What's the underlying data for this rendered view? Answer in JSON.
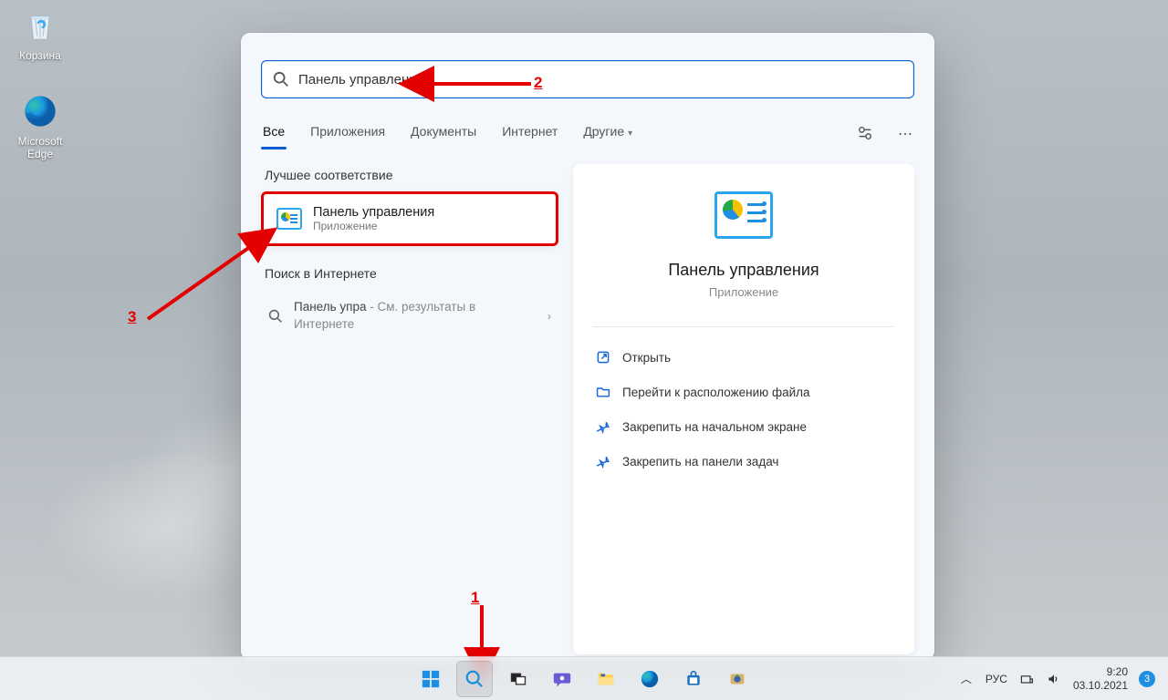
{
  "desktop": {
    "recycle_label": "Корзина",
    "edge_label": "Microsoft Edge"
  },
  "search": {
    "query": "Панель управления",
    "tabs": {
      "all": "Все",
      "apps": "Приложения",
      "docs": "Документы",
      "web": "Интернет",
      "more": "Другие"
    },
    "best_match_header": "Лучшее соответствие",
    "best_match": {
      "title": "Панель управления",
      "subtitle": "Приложение"
    },
    "web_header": "Поиск в Интернете",
    "web_item": {
      "prefix": "Панель упра",
      "suffix": " - См. результаты в Интернете"
    },
    "right": {
      "title": "Панель управления",
      "subtitle": "Приложение",
      "actions": {
        "open": "Открыть",
        "open_location": "Перейти к расположению файла",
        "pin_start": "Закрепить на начальном экране",
        "pin_taskbar": "Закрепить на панели задач"
      }
    }
  },
  "annotations": {
    "n1": "1",
    "n2": "2",
    "n3": "3"
  },
  "taskbar": {
    "lang": "РУС",
    "time": "9:20",
    "date": "03.10.2021",
    "notif_count": "3"
  }
}
